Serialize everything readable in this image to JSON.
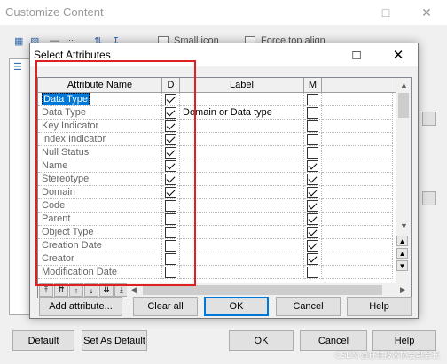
{
  "outer": {
    "title": "Customize Content",
    "toolbar": {
      "small_icon_label": "Small icon",
      "force_top_align_label": "Force top align"
    },
    "buttons": {
      "default": "Default",
      "set_as_default": "Set As Default",
      "ok": "OK",
      "cancel": "Cancel",
      "help": "Help"
    },
    "watermark": "CSDN @野生技术协会副会长"
  },
  "dialog": {
    "title": "Select Attributes",
    "columns": {
      "name": "Attribute Name",
      "d": "D",
      "label": "Label",
      "m": "M"
    },
    "rows": [
      {
        "name": "Data Type",
        "d": true,
        "label": "",
        "m": false,
        "selected": true
      },
      {
        "name": "Data Type",
        "d": true,
        "label": "Domain or Data type",
        "m": false
      },
      {
        "name": "Key Indicator",
        "d": true,
        "label": "",
        "m": false
      },
      {
        "name": "Index Indicator",
        "d": true,
        "label": "",
        "m": false
      },
      {
        "name": "Null Status",
        "d": true,
        "label": "",
        "m": false
      },
      {
        "name": "Name",
        "d": true,
        "label": "",
        "m": true
      },
      {
        "name": "Stereotype",
        "d": true,
        "label": "",
        "m": true
      },
      {
        "name": "Domain",
        "d": true,
        "label": "",
        "m": true
      },
      {
        "name": "Code",
        "d": false,
        "label": "",
        "m": true
      },
      {
        "name": "Parent",
        "d": false,
        "label": "",
        "m": true
      },
      {
        "name": "Object Type",
        "d": false,
        "label": "",
        "m": true
      },
      {
        "name": "Creation Date",
        "d": false,
        "label": "",
        "m": true
      },
      {
        "name": "Creator",
        "d": false,
        "label": "",
        "m": true
      },
      {
        "name": "Modification Date",
        "d": false,
        "label": "",
        "m": false
      }
    ],
    "buttons": {
      "add_attribute": "Add attribute...",
      "clear_all": "Clear all",
      "ok": "OK",
      "cancel": "Cancel",
      "help": "Help"
    }
  },
  "colors": {
    "selection": "#0078d7",
    "highlight_box": "#e02020",
    "default_button_border": "#0078d7"
  }
}
